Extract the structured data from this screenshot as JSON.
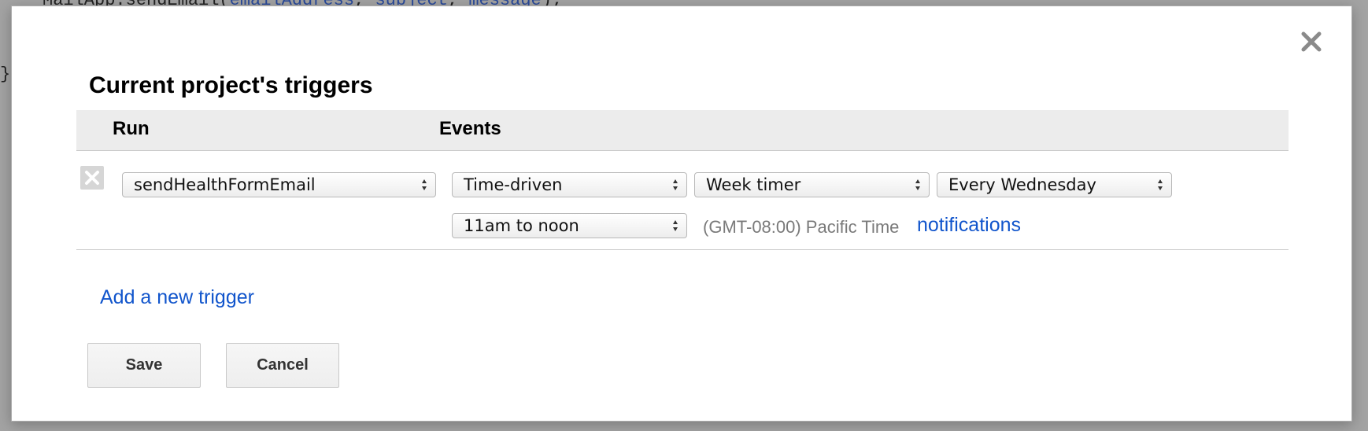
{
  "background_code": {
    "line_prefix": "MailApp.sendEmail(",
    "arg1": "emailAddress",
    "sep1": ", ",
    "arg2": "subject",
    "sep2": ", ",
    "arg3": "message",
    "line_suffix": ");",
    "closing_brace": "}"
  },
  "dialog": {
    "title": "Current project's triggers",
    "close_icon": "close-icon",
    "columns": {
      "run": "Run",
      "events": "Events"
    },
    "trigger": {
      "function": "sendHealthFormEmail",
      "event_source": "Time-driven",
      "timer_type": "Week timer",
      "day": "Every Wednesday",
      "time_of_day": "11am to noon",
      "timezone": "(GMT-08:00) Pacific Time",
      "notifications_label": "notifications",
      "delete_icon": "delete-x-icon"
    },
    "add_trigger_label": "Add a new trigger",
    "save_label": "Save",
    "cancel_label": "Cancel"
  },
  "colors": {
    "link": "#1155cc",
    "header_bg": "#ececec",
    "muted_text": "#7a7a7a"
  }
}
